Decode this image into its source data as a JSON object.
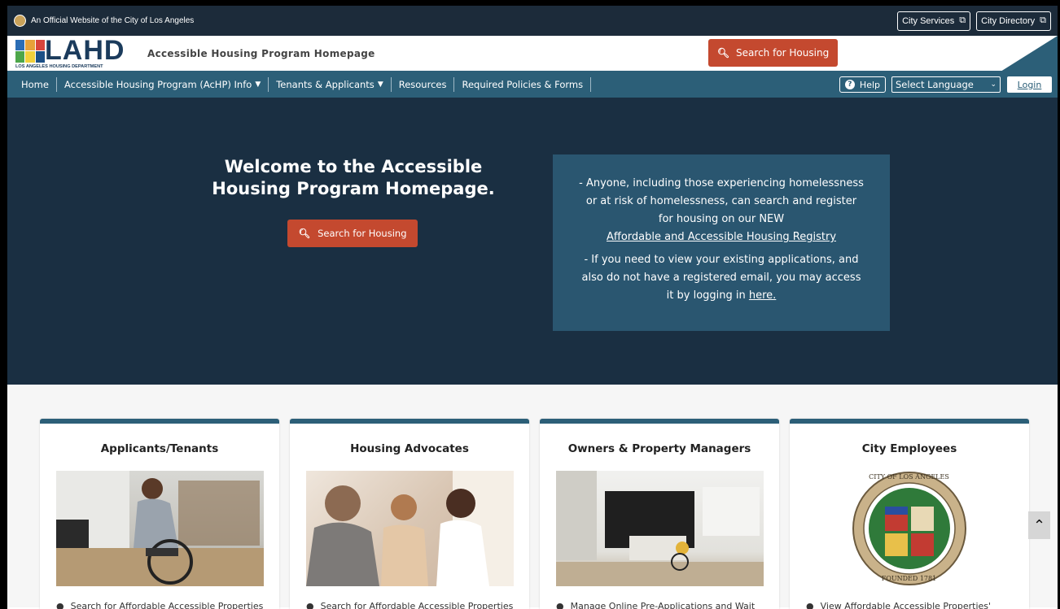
{
  "topbar": {
    "official_text": "An Official Website of the City of Los Angeles",
    "city_services": "City Services",
    "city_directory": "City Directory"
  },
  "header": {
    "logo_text": "LAHD",
    "logo_subtext": "LOS ANGELES HOUSING DEPARTMENT",
    "title": "Accessible Housing Program Homepage",
    "search_label": "Search for Housing"
  },
  "nav": {
    "items": [
      {
        "label": "Home"
      },
      {
        "label": "Accessible Housing Program (AcHP) Info"
      },
      {
        "label": "Tenants & Applicants"
      },
      {
        "label": "Resources"
      },
      {
        "label": "Required Policies & Forms"
      }
    ],
    "help_label": "Help",
    "language_selected": "Select Language",
    "login_label": "Login"
  },
  "hero": {
    "title_line1": "Welcome to the Accessible",
    "title_line2": "Housing Program Homepage.",
    "search_label": "Search for Housing",
    "info_para1": "- Anyone, including those experiencing homelessness or at risk of homelessness, can search and register for housing on our NEW",
    "info_link1": "Affordable and Accessible Housing Registry",
    "info_para2": "- If you need to view your existing applications, and also do not have a registered email, you may access it by logging in",
    "info_link2": "here."
  },
  "cards": [
    {
      "title": "Applicants/Tenants",
      "bullet": "Search for Affordable Accessible Properties"
    },
    {
      "title": "Housing Advocates",
      "bullet": "Search for Affordable Accessible Properties"
    },
    {
      "title": "Owners & Property Managers",
      "bullet": "Manage Online Pre-Applications and Wait"
    },
    {
      "title": "City Employees",
      "bullet": "View Affordable Accessible Properties'"
    }
  ],
  "seal": {
    "top_text": "CITY OF LOS ANGELES",
    "bottom_text": "FOUNDED 1781"
  },
  "colors": {
    "navy": "#1c2b3a",
    "teal": "#2c5f78",
    "accent": "#c4492f"
  }
}
